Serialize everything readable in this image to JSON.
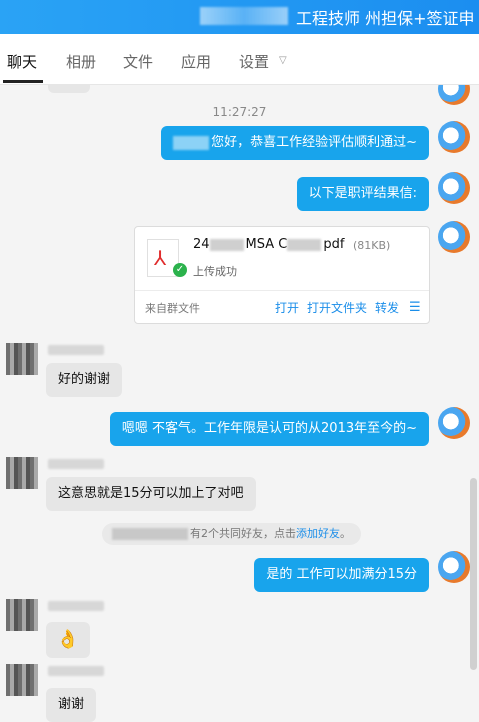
{
  "window": {
    "title": "工程技师 州担保+签证申"
  },
  "tabs": [
    {
      "label": "聊天"
    },
    {
      "label": "相册"
    },
    {
      "label": "文件"
    },
    {
      "label": "应用"
    },
    {
      "label": "设置"
    }
  ],
  "chat": {
    "timestamp": "11:27:27",
    "messages": {
      "m1": "您好，恭喜工作经验评估顺利通过~",
      "m2": "以下是职评结果信:",
      "m3": "好的谢谢",
      "m4": "嗯嗯 不客气。工作年限是认可的从2013年至今的~",
      "m5": "这意思就是15分可以加上了对吧",
      "m6": "是的 工作可以加满分15分",
      "m7_emoji": "👌",
      "m8": "谢谢"
    },
    "file": {
      "name_prefix": "24",
      "name_mid": "MSA C",
      "name_ext": "pdf",
      "size": "(81KB)",
      "status": "上传成功",
      "source": "来自群文件",
      "actions": [
        "打开",
        "打开文件夹",
        "转发"
      ]
    },
    "notice": {
      "text": "有2个共同好友，点击",
      "link": "添加好友",
      "end": "。"
    }
  },
  "icons": {
    "file": "pdf-icon",
    "success": "check-icon",
    "menu": "hamburger-icon",
    "chevron": "chevron-down-icon"
  },
  "colors": {
    "accent": "#18a4ec",
    "titlebar": "#2aa3f5"
  }
}
